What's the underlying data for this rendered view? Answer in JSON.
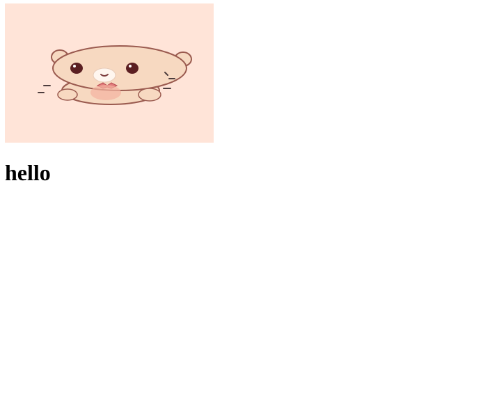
{
  "image": {
    "subject": "bear-illustration",
    "colors": {
      "background": "#FFE4D8",
      "fur": "#F7D9C1",
      "outline": "#9A5A4F",
      "bow": "#E07B7B",
      "eye": "#5B1F22"
    }
  },
  "heading": {
    "text": "hello"
  }
}
